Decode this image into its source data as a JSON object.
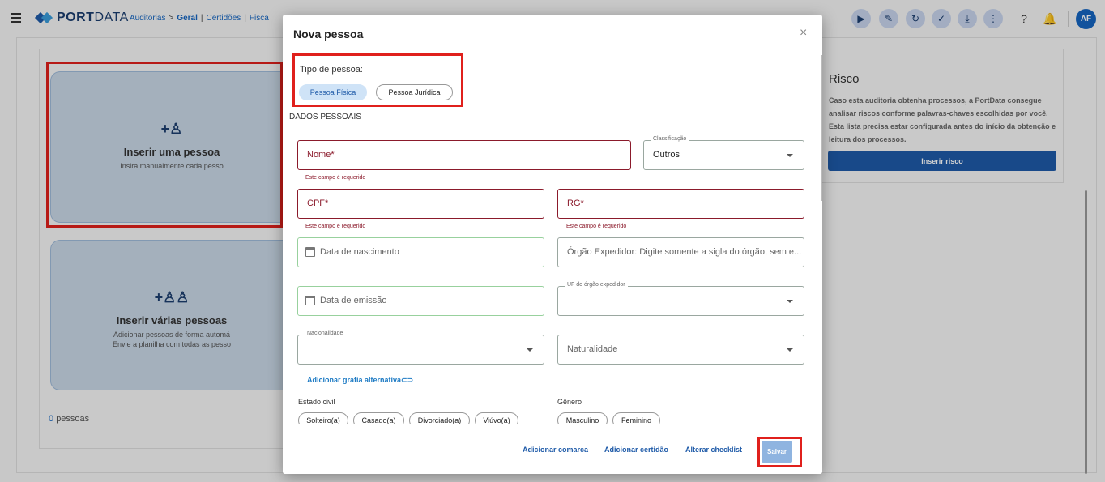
{
  "header": {
    "logo_bold": "PORT",
    "logo_light": "DATA",
    "breadcrumb": [
      "Auditorias",
      "Geral",
      "Certidões",
      "Fisca"
    ],
    "avatar": "AF"
  },
  "background": {
    "card_single": {
      "title": "Inserir uma pessoa",
      "subtitle": "Insira manualmente cada pesso"
    },
    "card_multi": {
      "title": "Inserir várias pessoas",
      "line1": "Adicionar pessoas de forma automá",
      "line2": "Envie a planilha com todas as pesso"
    },
    "count_number": "0",
    "count_label": "pessoas",
    "risk": {
      "title": "Risco",
      "description": "Caso esta auditoria obtenha processos, a PortData consegue analisar riscos conforme palavras-chaves escolhidas por você. Esta lista precisa estar configurada antes do início da obtenção e leitura dos processos.",
      "button": "Inserir risco"
    }
  },
  "modal": {
    "title": "Nova pessoa",
    "close": "×",
    "person_type_label": "Tipo de pessoa:",
    "person_types": [
      "Pessoa Física",
      "Pessoa Jurídica"
    ],
    "section_title": "DADOS PESSOAIS",
    "fields": {
      "nome": "Nome*",
      "classificacao_label": "Classificação",
      "classificacao_value": "Outros",
      "cpf": "CPF*",
      "rg": "RG*",
      "nascimento": "Data de nascimento",
      "orgao": "Órgão Expedidor: Digite somente a sigla do órgão, sem e...",
      "emissao": "Data de emissão",
      "uf_label": "UF do órgão expedidor",
      "nacionalidade_label": "Nacionalidade",
      "naturalidade": "Naturalidade"
    },
    "required_error": "Este campo é requerido",
    "alt_spelling_link": "Adicionar grafia alternativa",
    "civil_status_label": "Estado civil",
    "civil_status_options": [
      "Solteiro(a)",
      "Casado(a)",
      "Divorciado(a)",
      "Viúvo(a)"
    ],
    "gender_label": "Gênero",
    "gender_options": [
      "Masculino",
      "Feminino"
    ],
    "footer": {
      "add_comarca": "Adicionar comarca",
      "add_certidao": "Adicionar certidão",
      "alter_checklist": "Alterar checklist",
      "save": "Salvar"
    }
  },
  "colors": {
    "accent": "#1e5aa8",
    "error": "#8b1a2b",
    "highlight": "#e0201c"
  }
}
